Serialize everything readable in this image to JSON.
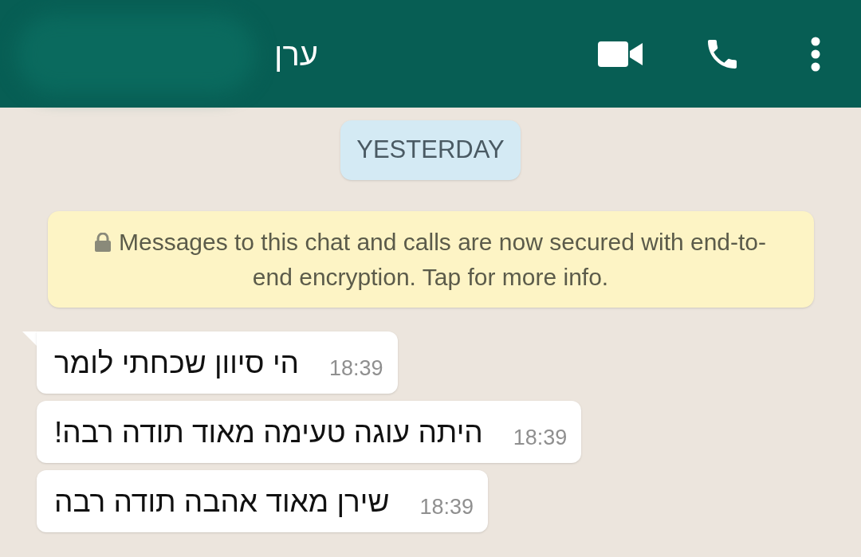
{
  "header": {
    "contact_name": "ערן"
  },
  "date_chip": "YESTERDAY",
  "encryption_notice": "Messages to this chat and calls are now secured with end-to-end encryption. Tap for more info.",
  "messages": [
    {
      "text": "הי סיוון שכחתי לומר",
      "time": "18:39",
      "first": true
    },
    {
      "text": "היתה עוגה טעימה מאוד תודה רבה!",
      "time": "18:39",
      "first": false
    },
    {
      "text": "שירן מאוד אהבה תודה רבה",
      "time": "18:39",
      "first": false
    }
  ]
}
